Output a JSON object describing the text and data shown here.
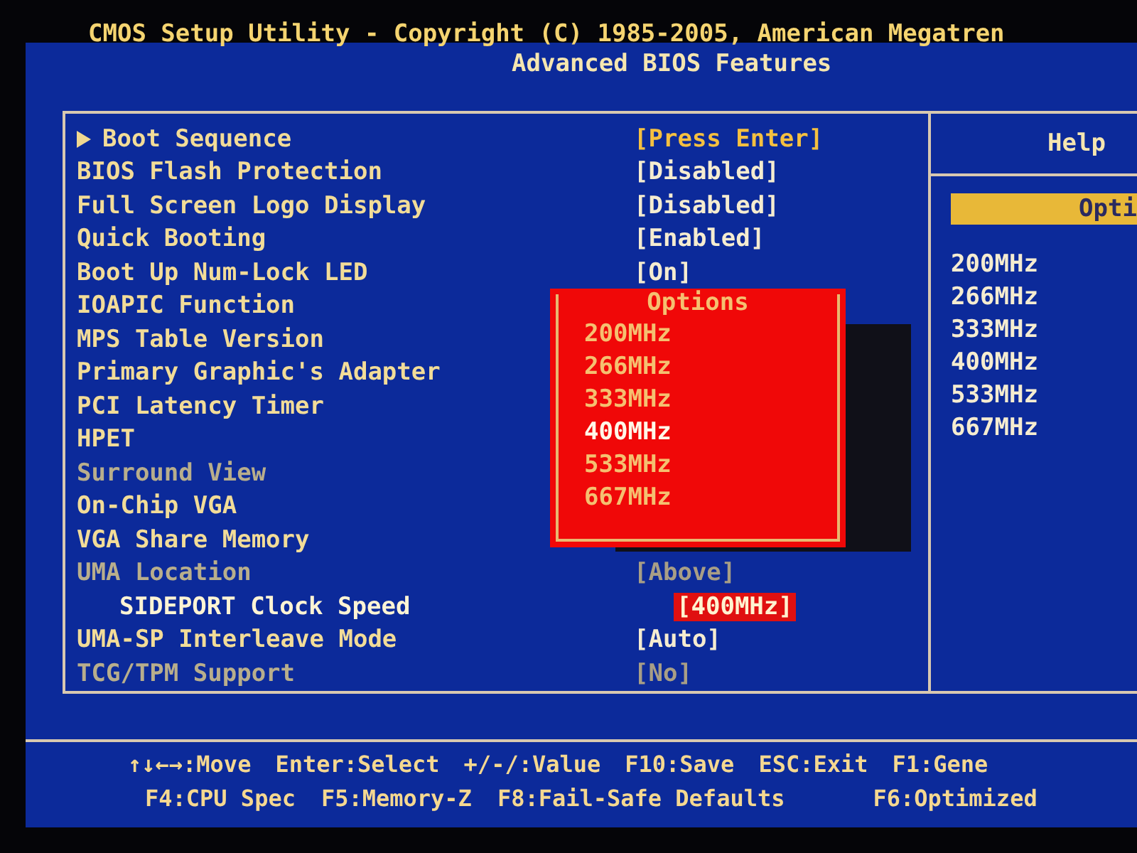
{
  "header": {
    "title": "CMOS Setup Utility - Copyright (C) 1985-2005, American Megatren",
    "subtitle": "Advanced BIOS Features"
  },
  "items": [
    {
      "label": "Boot Sequence",
      "value": "[Press Enter]",
      "kind": "submenu",
      "selected": false,
      "disabled": false
    },
    {
      "label": "BIOS Flash Protection",
      "value": "[Disabled]",
      "kind": "option",
      "selected": false,
      "disabled": false
    },
    {
      "label": "Full Screen Logo Display",
      "value": "[Disabled]",
      "kind": "option",
      "selected": false,
      "disabled": false
    },
    {
      "label": "Quick Booting",
      "value": "[Enabled]",
      "kind": "option",
      "selected": false,
      "disabled": false
    },
    {
      "label": "Boot Up Num-Lock LED",
      "value": "[On]",
      "kind": "option",
      "selected": false,
      "disabled": false
    },
    {
      "label": "IOAPIC Function",
      "kind": "option",
      "selected": false,
      "disabled": false
    },
    {
      "label": "MPS Table Version",
      "kind": "option",
      "selected": false,
      "disabled": false
    },
    {
      "label": "Primary Graphic's Adapter",
      "kind": "option",
      "selected": false,
      "disabled": false
    },
    {
      "label": "PCI Latency Timer",
      "kind": "option",
      "selected": false,
      "disabled": false
    },
    {
      "label": "HPET",
      "kind": "option",
      "selected": false,
      "disabled": false
    },
    {
      "label": "Surround View",
      "kind": "option",
      "selected": false,
      "disabled": true
    },
    {
      "label": "On-Chip VGA",
      "kind": "option",
      "selected": false,
      "disabled": false
    },
    {
      "label": "VGA Share Memory",
      "kind": "option",
      "selected": false,
      "disabled": false
    },
    {
      "label": "UMA Location",
      "value": "[Above]",
      "kind": "option",
      "selected": false,
      "disabled": true,
      "children": [
        {
          "label": "SIDEPORT Clock Speed",
          "value": "[400MHz]",
          "kind": "option",
          "selected": true,
          "disabled": false
        }
      ]
    },
    {
      "label": "UMA-SP Interleave Mode",
      "value": "[Auto]",
      "kind": "option",
      "selected": false,
      "disabled": false
    },
    {
      "label": "TCG/TPM Support",
      "value": "[No]",
      "kind": "option",
      "selected": false,
      "disabled": true
    }
  ],
  "options_popup": {
    "title": "Options",
    "options": [
      {
        "label": "200MHz",
        "selected": false
      },
      {
        "label": "266MHz",
        "selected": false
      },
      {
        "label": "333MHz",
        "selected": false
      },
      {
        "label": "400MHz",
        "selected": true
      },
      {
        "label": "533MHz",
        "selected": false
      },
      {
        "label": "667MHz",
        "selected": false
      }
    ]
  },
  "help": {
    "title": "Help",
    "section": "Opti",
    "lines": [
      "200MHz",
      "266MHz",
      "333MHz",
      "400MHz",
      "533MHz",
      "667MHz"
    ]
  },
  "footer": [
    [
      "↑↓←→:Move",
      "Enter:Select",
      "+/-/:Value",
      "F10:Save",
      "ESC:Exit",
      "F1:Gene"
    ],
    [
      "F4:CPU Spec",
      "F5:Memory-Z",
      "F8:Fail-Safe Defaults",
      "F6:Optimized"
    ]
  ]
}
